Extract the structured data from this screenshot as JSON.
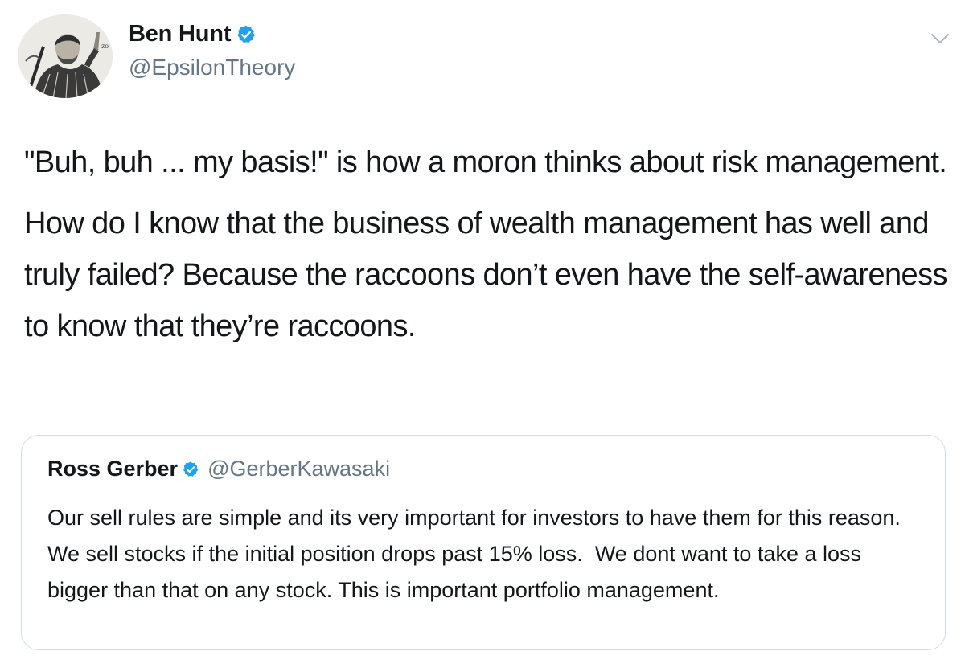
{
  "author": {
    "display_name": "Ben Hunt",
    "handle": "@EpsilonTheory",
    "verified": true,
    "avatar_icon": "engraved-portrait-avatar"
  },
  "tweet": {
    "paragraphs": [
      "\"Buh, buh ... my basis!\" is how a moron thinks about risk management.",
      "How do I know that the business of wealth management has well and truly failed? Because the raccoons don’t even have the self-awareness to know that they’re raccoons."
    ]
  },
  "quoted_tweet": {
    "display_name": "Ross Gerber",
    "handle": "@GerberKawasaki",
    "verified": true,
    "text": "Our sell rules are simple and its very important for investors to have them for this reason. We sell stocks if the initial position drops past 15% loss.  We dont want to take a loss bigger than that on any stock. This is important portfolio management."
  },
  "icons": {
    "verified": "verified-badge-icon",
    "menu": "chevron-down-icon"
  },
  "colors": {
    "text": "#14171a",
    "secondary": "#657786",
    "verified_blue": "#1da1f2",
    "card_border": "#d3dbe2"
  }
}
